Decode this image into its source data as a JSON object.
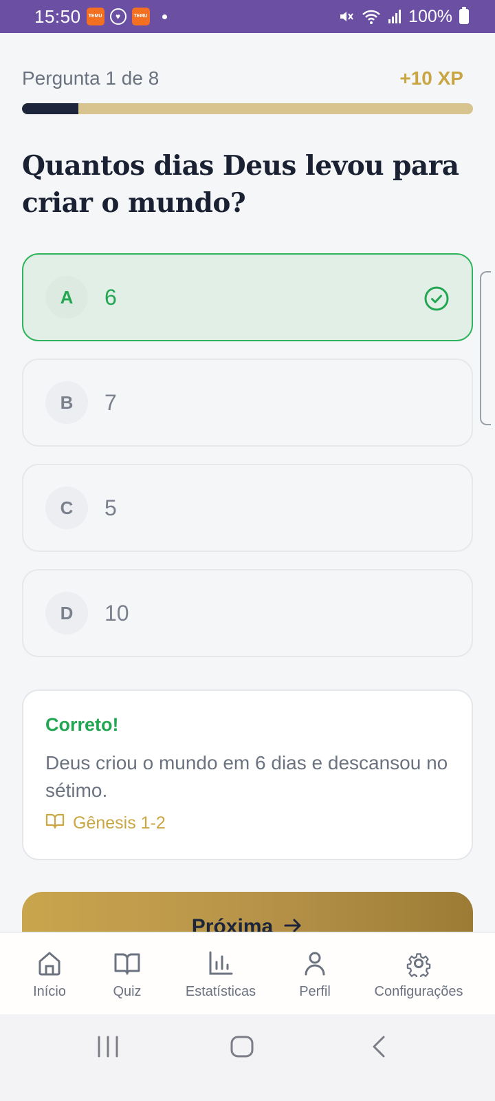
{
  "status_bar": {
    "time": "15:50",
    "app_badge_1": "TEMU",
    "app_badge_2": "TEMU",
    "battery": "100%"
  },
  "quiz": {
    "counter": "Pergunta 1 de 8",
    "xp": "+10 XP",
    "progress_fraction": 0.125,
    "question": "Quantos dias Deus levou para criar o mundo?",
    "options": [
      {
        "letter": "A",
        "text": "6",
        "state": "correct"
      },
      {
        "letter": "B",
        "text": "7",
        "state": "neutral"
      },
      {
        "letter": "C",
        "text": "5",
        "state": "neutral"
      },
      {
        "letter": "D",
        "text": "10",
        "state": "neutral"
      }
    ]
  },
  "feedback": {
    "title": "Correto!",
    "text": "Deus criou o mundo em 6 dias e descansou no sétimo.",
    "reference": "Gênesis 1-2"
  },
  "next_button": {
    "label": "Próxima"
  },
  "tabs": [
    {
      "label": "Início",
      "icon": "home-icon"
    },
    {
      "label": "Quiz",
      "icon": "book-icon"
    },
    {
      "label": "Estatísticas",
      "icon": "bar-chart-icon"
    },
    {
      "label": "Perfil",
      "icon": "user-icon"
    },
    {
      "label": "Configurações",
      "icon": "gear-icon"
    }
  ],
  "colors": {
    "status_bar": "#6b4fa3",
    "accent_gold": "#c9a643",
    "correct_green": "#22a652",
    "navy": "#1c2539"
  }
}
